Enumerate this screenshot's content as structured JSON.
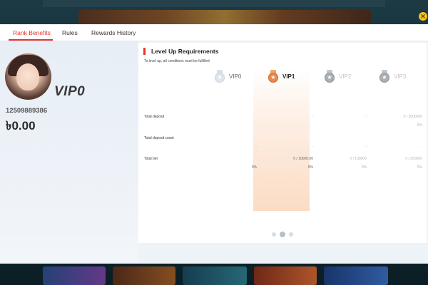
{
  "tabs": [
    {
      "label": "Rank Benefits",
      "active": true
    },
    {
      "label": "Rules",
      "active": false
    },
    {
      "label": "Rewards History",
      "active": false
    }
  ],
  "profile": {
    "vip_level": "VIP0",
    "user_id": "12509889386",
    "balance": "৳0.00"
  },
  "requirements": {
    "title": "Level Up Requirements",
    "note": "To level up, all conditions must be fulfilled",
    "levels": [
      {
        "name": "VIP0",
        "state": "current",
        "medal_icon": "silver-medal-icon"
      },
      {
        "name": "VIP1",
        "state": "next",
        "medal_icon": "bronze-medal-icon"
      },
      {
        "name": "VIP2",
        "state": "locked",
        "medal_icon": "silver-medal-icon"
      },
      {
        "name": "VIP3",
        "state": "locked",
        "medal_icon": "silver-medal-icon"
      }
    ],
    "rows": [
      {
        "label": "Total deposit",
        "vip1_progress": "-",
        "vip2_progress": "-",
        "vip3_progress": "0 / 2000000",
        "vip0_percent": "-",
        "vip1_percent": "-",
        "vip2_percent": "-",
        "vip3_percent": "0%"
      },
      {
        "label": "Total deposit count",
        "vip0": "-",
        "vip1": "-",
        "vip2": "-",
        "vip3": "-"
      },
      {
        "label": "Total bet",
        "vip1_progress": "0 / 10000.00",
        "vip2_progress": "0 / 100000",
        "vip3_progress": "0 / 200000",
        "vip0_percent": "0%",
        "vip1_percent": "0%",
        "vip2_percent": "0%",
        "vip3_percent": "0%"
      }
    ]
  },
  "pagination": {
    "active_index": 1
  },
  "colors": {
    "accent": "#e8322e",
    "close_button": "#f7c21d"
  }
}
